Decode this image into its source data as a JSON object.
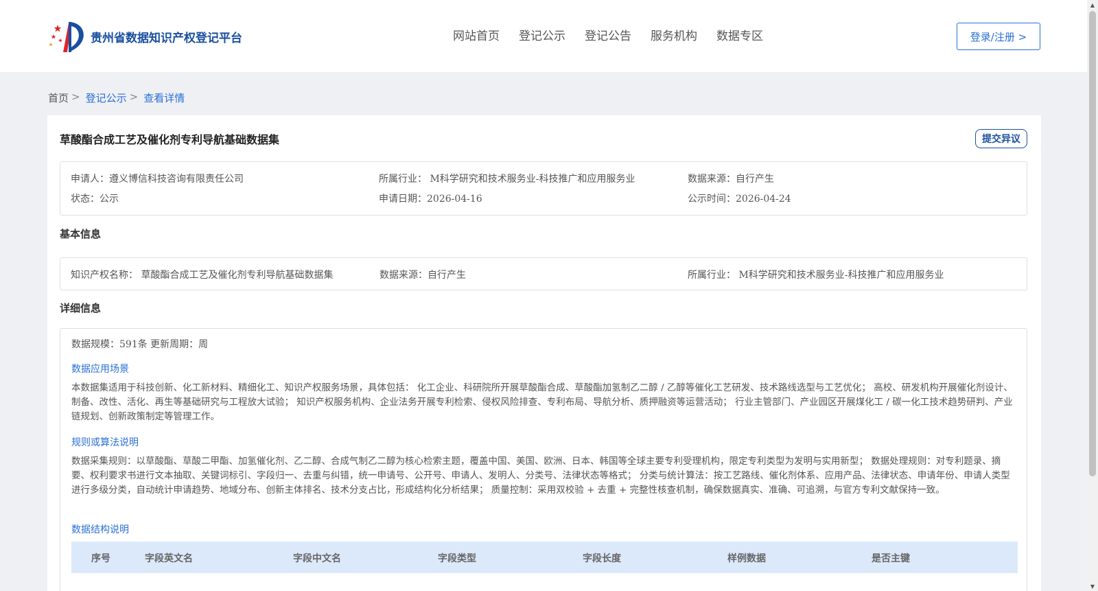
{
  "header": {
    "site_title": "贵州省数据知识产权登记平台",
    "nav": [
      "网站首页",
      "登记公示",
      "登记公告",
      "服务机构",
      "数据专区"
    ],
    "login_label": "登录/注册 >"
  },
  "breadcrumb": {
    "home": "首页",
    "sep": ">",
    "level1": "登记公示",
    "current": "查看详情"
  },
  "detail": {
    "title": "草酸酯合成工艺及催化剂专利导航基础数据集",
    "objection_label": "提交异议",
    "summary": {
      "applicant": "申请人：遵义博信科技咨询有限责任公司",
      "industry": "所属行业： M科学研究和技术服务业-科技推广和应用服务业",
      "source": "数据来源：自行产生",
      "status": "状态：公示",
      "apply_date": "申请日期：2026-04-16",
      "publish_date": "公示时间：2026-04-24"
    },
    "basic_heading": "基本信息",
    "basic": {
      "ip_name": "知识产权名称： 草酸酯合成工艺及催化剂专利导航基础数据集",
      "source": "数据来源：自行产生",
      "industry": "所属行业： M科学研究和技术服务业-科技推广和应用服务业"
    },
    "detail_heading": "详细信息",
    "scale_line": "数据规模：591条 更新周期：周",
    "scenario_heading": "数据应用场景",
    "scenario_text": "本数据集适用于科技创新、化工新材料、精细化工、知识产权服务场景，具体包括： 化工企业、科研院所开展草酸酯合成、草酸酯加氢制乙二醇 / 乙醇等催化工艺研发、技术路线选型与工艺优化； 高校、研发机构开展催化剂设计、制备、改性、活化、再生等基础研究与工程放大试验； 知识产权服务机构、企业法务开展专利检索、侵权风险排查、专利布局、导航分析、质押融资等运营活动； 行业主管部门、产业园区开展煤化工 / 碳一化工技术趋势研判、产业链规划、创新政策制定等管理工作。",
    "rules_heading": "规则或算法说明",
    "rules_text": "数据采集规则：以草酸酯、草酸二甲酯、加氢催化剂、乙二醇、合成气制乙二醇为核心检索主题，覆盖中国、美国、欧洲、日本、韩国等全球主要专利受理机构，限定专利类型为发明与实用新型； 数据处理规则：对专利题录、摘要、权利要求书进行文本抽取、关键词标引、字段归一、去重与纠错，统一申请号、公开号、申请人、发明人、分类号、法律状态等格式； 分类与统计算法：按工艺路线、催化剂体系、应用产品、法律状态、申请年份、申请人类型进行多级分类，自动统计申请趋势、地域分布、创新主体排名、技术分支占比，形成结构化分析结果； 质量控制：采用双校验 + 去重 + 完整性核查机制，确保数据真实、准确、可追溯，与官方专利文献保持一致。",
    "structure_heading": "数据结构说明",
    "table_columns": [
      "序号",
      "字段英文名",
      "字段中文名",
      "字段类型",
      "字段长度",
      "样例数据",
      "是否主键"
    ]
  }
}
